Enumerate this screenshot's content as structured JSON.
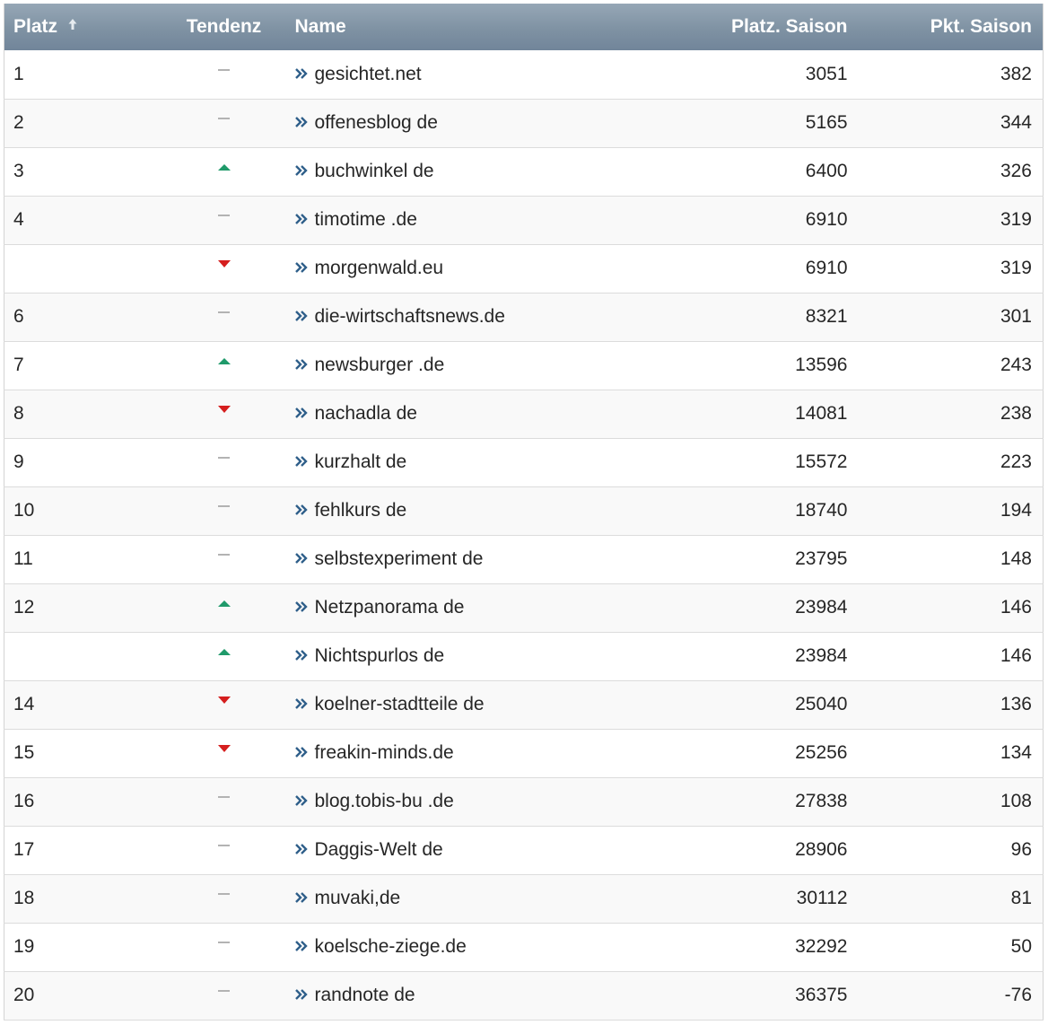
{
  "table": {
    "headers": {
      "platz": "Platz",
      "tendenz": "Tendenz",
      "name": "Name",
      "platz_saison": "Platz. Saison",
      "pkt_saison": "Pkt. Saison"
    },
    "sort_icon": "sort-up-arrow-icon",
    "link_icon": "double-chevron-right-icon",
    "colors": {
      "header": "#7f92a3",
      "trend_up": "#1f9a6a",
      "trend_down": "#d51e1e",
      "trend_same": "#b3b3b3",
      "link_arrow": "#2f5f8a"
    },
    "rows": [
      {
        "platz": "1",
        "trend": "same",
        "name": "gesichtet.net",
        "platz_saison": "3051",
        "pkt_saison": "382"
      },
      {
        "platz": "2",
        "trend": "same",
        "name": "offenesblog de",
        "platz_saison": "5165",
        "pkt_saison": "344"
      },
      {
        "platz": "3",
        "trend": "up",
        "name": "buchwinkel de",
        "platz_saison": "6400",
        "pkt_saison": "326"
      },
      {
        "platz": "4",
        "trend": "same",
        "name": "timotime .de",
        "platz_saison": "6910",
        "pkt_saison": "319"
      },
      {
        "platz": "",
        "trend": "down",
        "name": "morgenwald.eu",
        "platz_saison": "6910",
        "pkt_saison": "319"
      },
      {
        "platz": "6",
        "trend": "same",
        "name": "die-wirtschaftsnews.de",
        "platz_saison": "8321",
        "pkt_saison": "301"
      },
      {
        "platz": "7",
        "trend": "up",
        "name": "newsburger .de",
        "platz_saison": "13596",
        "pkt_saison": "243"
      },
      {
        "platz": "8",
        "trend": "down",
        "name": "nachadla de",
        "platz_saison": "14081",
        "pkt_saison": "238"
      },
      {
        "platz": "9",
        "trend": "same",
        "name": "kurzhalt de",
        "platz_saison": "15572",
        "pkt_saison": "223"
      },
      {
        "platz": "10",
        "trend": "same",
        "name": "fehlkurs de",
        "platz_saison": "18740",
        "pkt_saison": "194"
      },
      {
        "platz": "11",
        "trend": "same",
        "name": "selbstexperiment de",
        "platz_saison": "23795",
        "pkt_saison": "148"
      },
      {
        "platz": "12",
        "trend": "up",
        "name": "Netzpanorama de",
        "platz_saison": "23984",
        "pkt_saison": "146"
      },
      {
        "platz": "",
        "trend": "up",
        "name": "Nichtspurlos de",
        "platz_saison": "23984",
        "pkt_saison": "146"
      },
      {
        "platz": "14",
        "trend": "down",
        "name": "koelner-stadtteile de",
        "platz_saison": "25040",
        "pkt_saison": "136"
      },
      {
        "platz": "15",
        "trend": "down",
        "name": "freakin-minds.de",
        "platz_saison": "25256",
        "pkt_saison": "134"
      },
      {
        "platz": "16",
        "trend": "same",
        "name": "blog.tobis-bu .de",
        "platz_saison": "27838",
        "pkt_saison": "108"
      },
      {
        "platz": "17",
        "trend": "same",
        "name": "Daggis-Welt de",
        "platz_saison": "28906",
        "pkt_saison": "96"
      },
      {
        "platz": "18",
        "trend": "same",
        "name": "muvaki,de",
        "platz_saison": "30112",
        "pkt_saison": "81"
      },
      {
        "platz": "19",
        "trend": "same",
        "name": "koelsche-ziege.de",
        "platz_saison": "32292",
        "pkt_saison": "50"
      },
      {
        "platz": "20",
        "trend": "same",
        "name": "randnote de",
        "platz_saison": "36375",
        "pkt_saison": "-76"
      }
    ]
  }
}
